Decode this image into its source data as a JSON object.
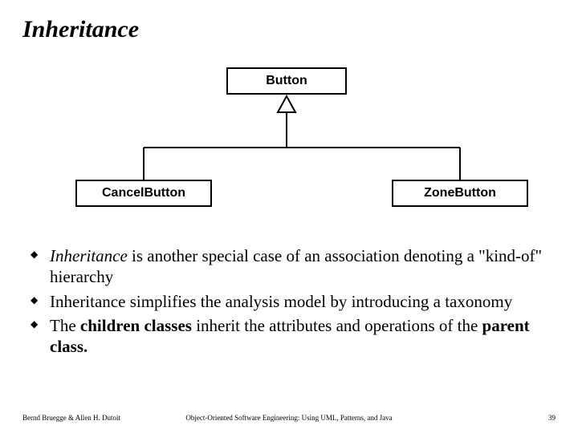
{
  "title": "Inheritance",
  "diagram": {
    "parent_class": "Button",
    "child_left": "CancelButton",
    "child_right": "ZoneButton"
  },
  "bullets": {
    "b1_lead": "Inheritance",
    "b1_rest": " is another special case of an association denoting a \"kind-of\" hierarchy",
    "b2": "Inheritance simplifies the analysis model by introducing a taxonomy",
    "b3_pre": "The ",
    "b3_children": "children classes",
    "b3_mid": " inherit the attributes and operations of the ",
    "b3_parent": "parent class.",
    "b3_post": ""
  },
  "footer": {
    "left": "Bernd Bruegge & Allen H. Dutoit",
    "center": "Object-Oriented Software Engineering: Using UML, Patterns, and Java",
    "right": "39"
  }
}
